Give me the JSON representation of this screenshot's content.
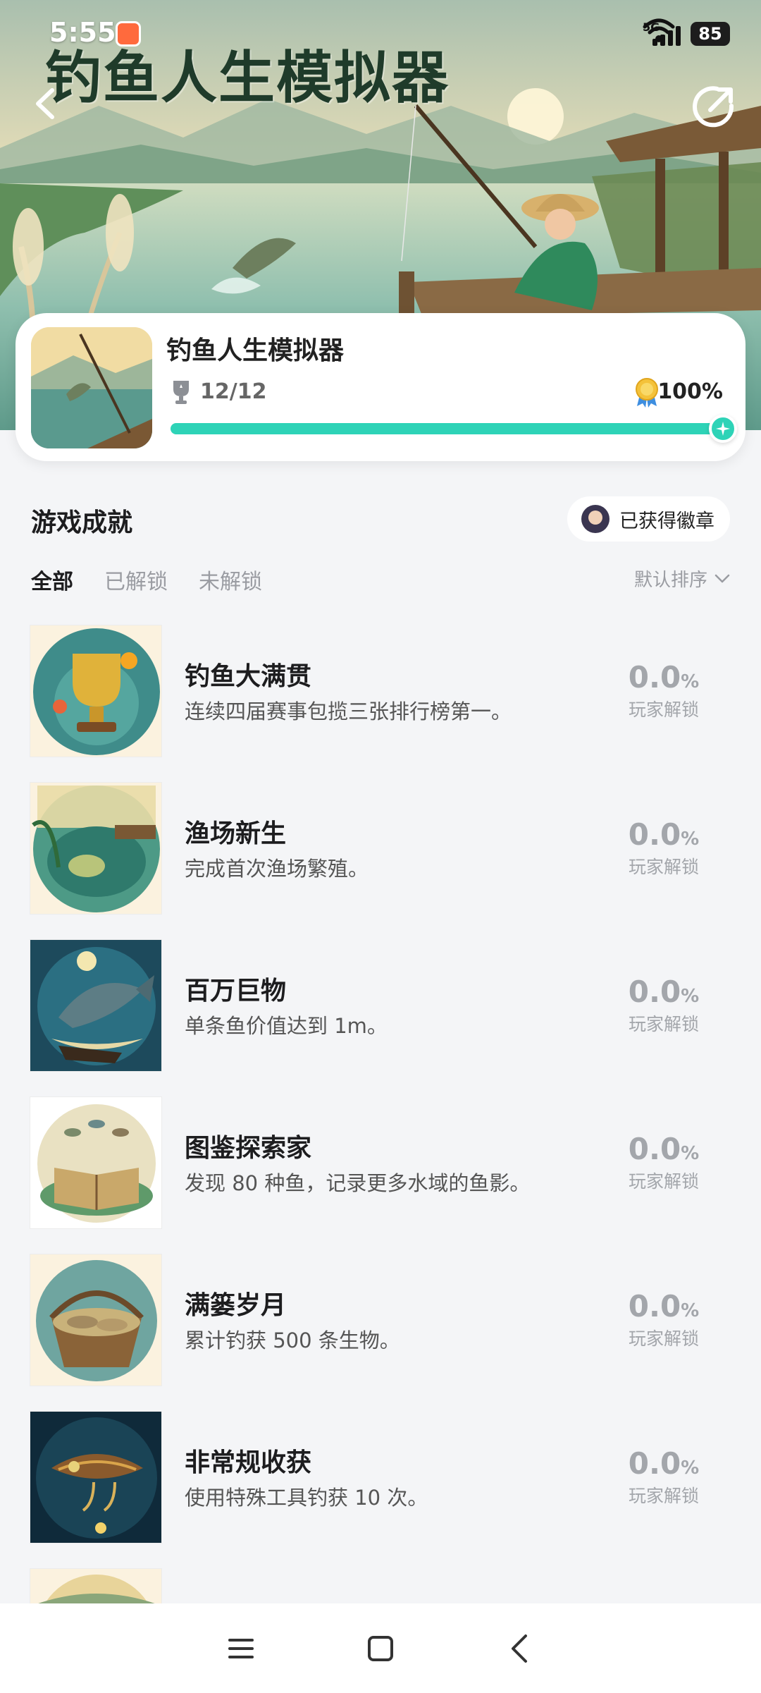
{
  "status_bar": {
    "time": "5:55",
    "network": "5G",
    "battery": "85"
  },
  "hero": {
    "title": "钓鱼人生模拟器"
  },
  "game": {
    "name": "钓鱼人生模拟器",
    "trophy_count": "12/12",
    "completion_percent": "100%",
    "completion_fraction": 1.0
  },
  "achievements": {
    "section_title": "游戏成就",
    "badge_button_label": "已获得徽章",
    "tabs": [
      {
        "label": "全部",
        "active": true
      },
      {
        "label": "已解锁",
        "active": false
      },
      {
        "label": "未解锁",
        "active": false
      }
    ],
    "sort_label": "默认排序",
    "items": [
      {
        "title": "钓鱼大满贯",
        "desc": "连续四届赛事包揽三张排行榜第一。",
        "value": "0.0",
        "unit": "%",
        "label": "玩家解锁",
        "icon": "golden-trophy-icon"
      },
      {
        "title": "渔场新生",
        "desc": "完成首次渔场繁殖。",
        "value": "0.0",
        "unit": "%",
        "label": "玩家解锁",
        "icon": "fish-pond-icon"
      },
      {
        "title": "百万巨物",
        "desc": "单条鱼价值达到 1m。",
        "value": "0.0",
        "unit": "%",
        "label": "玩家解锁",
        "icon": "giant-fish-icon"
      },
      {
        "title": "图鉴探索家",
        "desc": "发现 80 种鱼，记录更多水域的鱼影。",
        "value": "0.0",
        "unit": "%",
        "label": "玩家解锁",
        "icon": "fish-book-icon"
      },
      {
        "title": "满篓岁月",
        "desc": "累计钓获 500 条生物。",
        "value": "0.0",
        "unit": "%",
        "label": "玩家解锁",
        "icon": "fish-basket-icon"
      },
      {
        "title": "非常规收获",
        "desc": "使用特殊工具钓获 10 次。",
        "value": "0.0",
        "unit": "%",
        "label": "玩家解锁",
        "icon": "fishing-lure-icon"
      }
    ]
  },
  "colors": {
    "accent": "#2ed3b7",
    "muted": "#a3a6ab",
    "background": "#f4f5f7"
  }
}
